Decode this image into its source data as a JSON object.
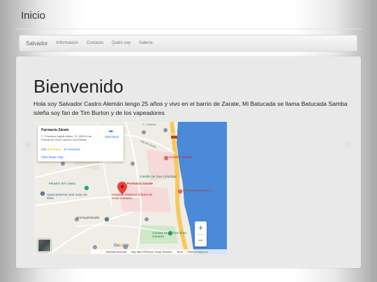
{
  "header": {
    "site_title": "Inicio"
  },
  "navbar": {
    "brand": "Salvador",
    "links": [
      "Información",
      "Contacto",
      "Quién soy",
      "Galería"
    ]
  },
  "hero": {
    "heading": "Bienvenido",
    "intro": "Hola soy Salvador Castro Alemán tengo 25 años y vivo en el barrio de Zarate, Mi Batucada se llama Batucada Samba isleña soy fan de Tim Burton y de los vapeadores"
  },
  "carousel": {
    "prev_icon": "chevron-left-icon",
    "next_icon": "chevron-right-icon",
    "arrow_color": "#ffffff"
  },
  "map": {
    "place": {
      "name": "Farmacia Zárate",
      "address": "C. Francisco Inglott Artiles, 23, 35016 Las Palmas de Gran Canaria, Las Palmas",
      "rating": "3.8",
      "stars": "★★★★★",
      "reviews": "17 reviews",
      "larger_map": "View larger map",
      "directions": "Directions"
    },
    "labels": {
      "pin": "Farmacia Zarate",
      "hospital": "Hospital Insular",
      "castillo": "Castillo de San Cristóbal",
      "polideportivo": "Polideportivo San C...",
      "mirador": "Mirador del Lasso",
      "aparcamiento": "Aparcamiento San Juan de Dios",
      "hospital_materno": "Hospital Materno Infantil de Gran Canaria",
      "connyart": "Connyartstudio",
      "ciudad_deportiva": "Ciudad Deportiva Gran Canaria",
      "street_cordoba": "C. Córdoba",
      "street_villa": "Villa de Zarate",
      "road_gc1": "GC-1"
    },
    "zoom_in": "+",
    "zoom_out": "−",
    "google_letters": [
      "G",
      "o",
      "o",
      "g",
      "l",
      "e"
    ],
    "google_colors": [
      "#4285f4",
      "#ea4335",
      "#fbbc05",
      "#4285f4",
      "#34a853",
      "#ea4335"
    ],
    "footer": [
      "Keyboard shortcuts",
      "Map data ©2023 Inst. Geogr. Nacional",
      "Terms",
      "Report a map error"
    ],
    "colors": {
      "sea": "#4a8ad8",
      "land": "#f0ede6",
      "highway": "#f7c95a",
      "pin": "#ea4335",
      "hospital_area": "#f6dada",
      "park": "#cfe8c5"
    }
  }
}
